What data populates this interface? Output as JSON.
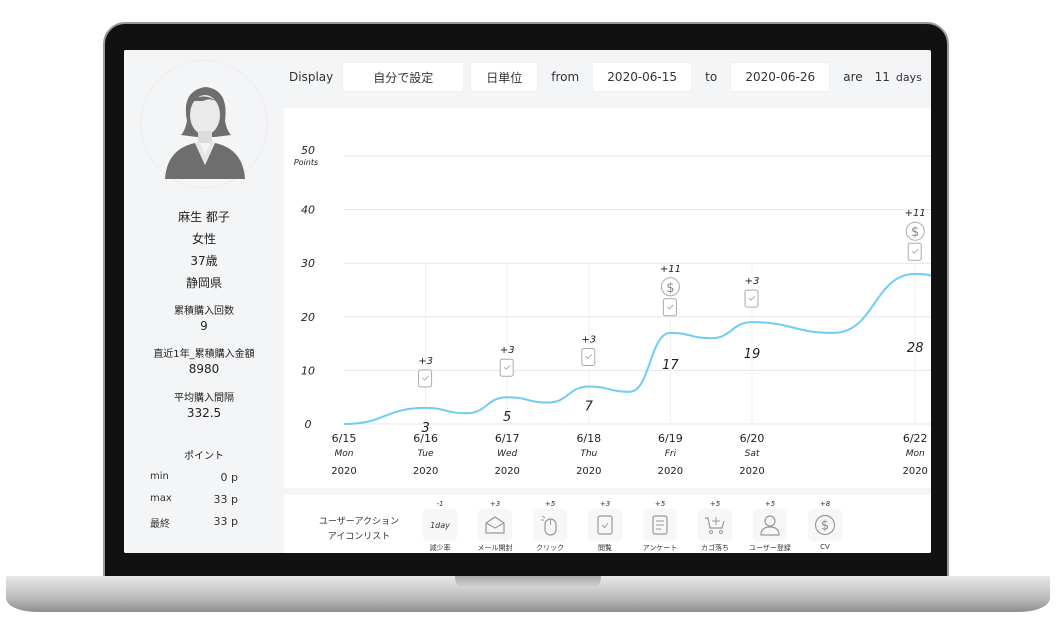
{
  "toolbar": {
    "display_label": "Display",
    "mode": "自分で設定",
    "unit": "日単位",
    "from_label": "from",
    "from_date": "2020-06-15",
    "to_label": "to",
    "to_date": "2020-06-26",
    "are_label": "are",
    "days_count": "11",
    "days_unit": "days"
  },
  "profile": {
    "name": "麻生 都子",
    "gender": "女性",
    "age": "37歳",
    "prefecture": "静岡県",
    "stats": [
      {
        "label": "累積購入回数",
        "value": "9"
      },
      {
        "label": "直近1年_累積購入金額",
        "value": "8980"
      },
      {
        "label": "平均購入間隔",
        "value": "332.5"
      }
    ],
    "points_title": "ポイント",
    "points": [
      {
        "label": "min",
        "value": "0 p"
      },
      {
        "label": "max",
        "value": "33 p"
      },
      {
        "label": "最終",
        "value": "33 p"
      }
    ]
  },
  "chart_data": {
    "type": "line",
    "ylabel": "Points",
    "ylim": [
      0,
      50
    ],
    "yticks": [
      0,
      10,
      20,
      30,
      40,
      50
    ],
    "line_color": "#6fcdf5",
    "x_ticks": [
      {
        "date": "6/15",
        "day": "Mon",
        "year": "2020"
      },
      {
        "date": "6/16",
        "day": "Tue",
        "year": "2020"
      },
      {
        "date": "6/17",
        "day": "Wed",
        "year": "2020"
      },
      {
        "date": "6/18",
        "day": "Thu",
        "year": "2020"
      },
      {
        "date": "6/19",
        "day": "Fri",
        "year": "2020"
      },
      {
        "date": "6/20",
        "day": "Sat",
        "year": "2020"
      },
      {
        "date": "6/22",
        "day": "Mon",
        "year": "2020"
      }
    ],
    "series": [
      {
        "x": [
          "6/15",
          "6/16",
          "6/16.5",
          "6/17",
          "6/17.5",
          "6/18",
          "6/18.5",
          "6/19",
          "6/19.5",
          "6/20",
          "6/21",
          "6/22",
          "6/22.5"
        ],
        "values": [
          0,
          3,
          2,
          5,
          4,
          7,
          6,
          17,
          16,
          19,
          17,
          28,
          27
        ]
      }
    ],
    "data_labels": [
      {
        "date": "6/16",
        "value": "3"
      },
      {
        "date": "6/17",
        "value": "5"
      },
      {
        "date": "6/18",
        "value": "7"
      },
      {
        "date": "6/19",
        "value": "17"
      },
      {
        "date": "6/20",
        "value": "19"
      },
      {
        "date": "6/22",
        "value": "28"
      }
    ],
    "annotations": [
      {
        "date": "6/16",
        "delta": "+3",
        "icons": [
          "check-icon"
        ]
      },
      {
        "date": "6/17",
        "delta": "+3",
        "icons": [
          "check-icon"
        ]
      },
      {
        "date": "6/18",
        "delta": "+3",
        "icons": [
          "check-icon"
        ]
      },
      {
        "date": "6/19",
        "delta": "+11",
        "icons": [
          "dollar-icon",
          "check-icon"
        ]
      },
      {
        "date": "6/20",
        "delta": "+3",
        "icons": [
          "check-icon"
        ]
      },
      {
        "date": "6/22",
        "delta": "+11",
        "icons": [
          "dollar-icon",
          "check-icon"
        ]
      }
    ]
  },
  "actions": {
    "title_line1": "ユーザーアクション",
    "title_line2": "アイコンリスト",
    "items": [
      {
        "points": "-1",
        "label": "減少率",
        "icon": "1day",
        "icon_text": "1day"
      },
      {
        "points": "+3",
        "label": "メール開封",
        "icon": "mail-open-icon"
      },
      {
        "points": "+5",
        "label": "クリック",
        "icon": "mouse-click-icon"
      },
      {
        "points": "+3",
        "label": "閲覧",
        "icon": "check-icon"
      },
      {
        "points": "+5",
        "label": "アンケート",
        "icon": "survey-icon"
      },
      {
        "points": "+5",
        "label": "カゴ落ち",
        "icon": "cart-icon"
      },
      {
        "points": "+5",
        "label": "ユーザー登録",
        "icon": "user-icon"
      },
      {
        "points": "+8",
        "label": "CV",
        "icon": "dollar-icon"
      }
    ]
  }
}
